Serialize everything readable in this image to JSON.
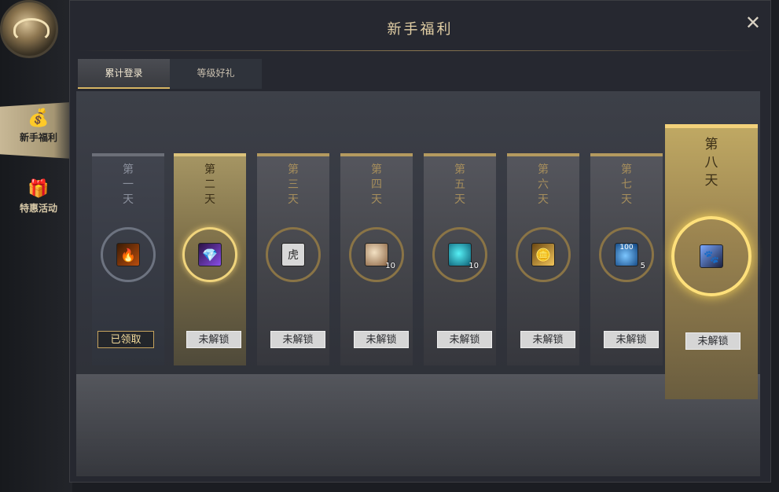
{
  "title": "新手福利",
  "close_icon": "✕",
  "sidebar": [
    {
      "label": "新手福利",
      "icon": "money-bag-icon",
      "active": true
    },
    {
      "label": "特惠活动",
      "icon": "gift-box-icon",
      "active": false
    }
  ],
  "tabs": [
    {
      "label": "累计登录",
      "active": true
    },
    {
      "label": "等级好礼",
      "active": false
    }
  ],
  "days": [
    {
      "day_label": "第一天",
      "item_icon": "fire-orb-icon",
      "count": "",
      "button": "已领取",
      "state": "claimed"
    },
    {
      "day_label": "第二天",
      "item_icon": "purple-gem-icon",
      "count": "",
      "button": "未解锁",
      "state": "gold"
    },
    {
      "day_label": "第三天",
      "item_icon": "tiger-card-icon",
      "count": "",
      "button": "未解锁",
      "state": "locked"
    },
    {
      "day_label": "第四天",
      "item_icon": "orb-icon",
      "count": "10",
      "button": "未解锁",
      "state": "locked"
    },
    {
      "day_label": "第五天",
      "item_icon": "blue-swirl-icon",
      "count": "10",
      "button": "未解锁",
      "state": "locked"
    },
    {
      "day_label": "第六天",
      "item_icon": "gold-coins-icon",
      "count": "",
      "button": "未解锁",
      "state": "locked"
    },
    {
      "day_label": "第七天",
      "item_icon": "blue-potion-100-icon",
      "count": "5",
      "button": "未解锁",
      "state": "locked"
    },
    {
      "day_label": "第八天",
      "item_icon": "mount-icon",
      "count": "",
      "button": "未解锁",
      "state": "big"
    }
  ],
  "item_texts": [
    "100"
  ],
  "colors": {
    "accent_gold": "#d7b563",
    "panel_dark": "#262830",
    "claimed_border": "#c6a35d"
  }
}
